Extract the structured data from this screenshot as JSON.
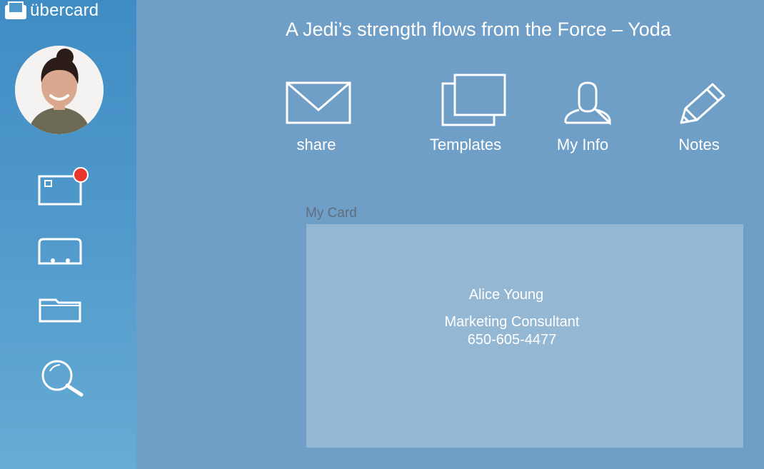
{
  "app": {
    "name": "übercard"
  },
  "header": {
    "quote": "A Jedi’s strength flows from the Force – Yoda"
  },
  "sidebar": {
    "items": [
      {
        "name": "inbox",
        "icon": "mail-card-icon",
        "has_badge": true
      },
      {
        "name": "cards",
        "icon": "card-tray-icon"
      },
      {
        "name": "folders",
        "icon": "folder-icon"
      },
      {
        "name": "search",
        "icon": "search-icon"
      }
    ],
    "badge_color": "#e8382d"
  },
  "actions": [
    {
      "label": "share",
      "icon": "envelope-icon"
    },
    {
      "label": "Templates",
      "icon": "templates-icon"
    },
    {
      "label": "My Info",
      "icon": "person-icon"
    },
    {
      "label": "Notes",
      "icon": "pencil-icon"
    }
  ],
  "card": {
    "caption": "My Card",
    "name": "Alice Young",
    "title": "Marketing Consultant",
    "phone": "650-605-4477"
  },
  "colors": {
    "background": "#6f9ec6",
    "sidebar_top": "#3f8cc4",
    "card": "#94b7d4",
    "caption": "#5f6f7c"
  }
}
